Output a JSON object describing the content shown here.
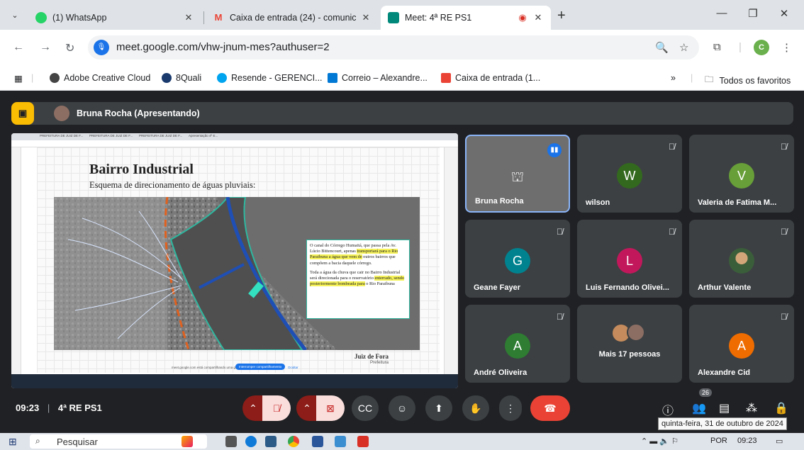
{
  "browser": {
    "tabs": [
      {
        "label": "(1) WhatsApp",
        "favicon_color": "#25d366",
        "badge": "1"
      },
      {
        "label": "Caixa de entrada (24) - comunic",
        "favicon_color": "#ea4335",
        "favicon_glyph": "M"
      },
      {
        "label": "Meet: 4ª RE PS1",
        "favicon_color": "#00897b"
      }
    ],
    "url": "meet.google.com/vhw-jnum-mes?authuser=2",
    "profile_initial": "C",
    "bookmarks": [
      {
        "label": "Adobe Creative Cloud",
        "color": "#444"
      },
      {
        "label": "8Quali",
        "color": "#1a3a6e"
      },
      {
        "label": "Resende - GERENCI...",
        "color": "#00a4ef"
      },
      {
        "label": "Correio – Alexandre...",
        "color": "#0078d4"
      },
      {
        "label": "Caixa de entrada (1...",
        "color": "#ea4335"
      }
    ],
    "all_favorites": "Todos os favoritos",
    "more_bookmarks": "»"
  },
  "meet": {
    "presenter_label": "Bruna Rocha (Apresentando)",
    "meeting_time": "09:23",
    "meeting_name": "4ª RE PS1",
    "people_count": "26",
    "participants": [
      {
        "name": "Bruna Rocha",
        "speaking": true
      },
      {
        "name": "wilson",
        "initial": "W",
        "color": "#33691e"
      },
      {
        "name": "Valeria de Fatima M...",
        "initial": "V",
        "color": "#689f38"
      },
      {
        "name": "Geane Fayer",
        "initial": "G",
        "color": "#00838f"
      },
      {
        "name": "Luis Fernando Olivei...",
        "initial": "L",
        "color": "#c2185b"
      },
      {
        "name": "Arthur Valente",
        "photo": true
      },
      {
        "name": "André Oliveira",
        "initial": "A",
        "color": "#2e7d32"
      },
      {
        "name": "Mais 17 pessoas"
      },
      {
        "name": "Alexandre Cid",
        "initial": "A",
        "color": "#ef6c00"
      }
    ]
  },
  "shared_screen": {
    "slide_title": "Bairro Industrial",
    "slide_subtitle": "Esquema de direcionamento de águas pluviais:",
    "note_p1_a": "O canal do Córrego Humaitá, que passa pela Av. Lúcio Bittencourt, apenas ",
    "note_p1_hl": "transportará para o Rio Paraibuna a água que vem de",
    "note_p1_b": " outros bairros que compõem a bacia daquele córrego.",
    "note_p2_a": "Toda a água da chuva que cair no Bairro Industrial será direcionada para o reservatório ",
    "note_p2_hl": "enterrado, sendo posteriormente bombeada para",
    "note_p2_b": " o Rio Paraibuna",
    "logo": "Juiz de Fora",
    "logo_sub": "Prefeitura",
    "share_notice": "meet.google.com está compartilhando uma guia",
    "share_stop": "Interromper compartilhamento",
    "share_hide": "Ocultar",
    "inner_tabs": [
      "PREFEITURA DE JUIZ DE F...",
      "PREFEITURA DE JUIZ DE F...",
      "PREFEITURA DE JUIZ DE F...",
      "Apresentação 4ª E..."
    ]
  },
  "windows": {
    "search_placeholder": "Pesquisar",
    "language": "POR",
    "clock": "09:23",
    "date_tooltip": "quinta-feira, 31 de outubro de 2024"
  }
}
